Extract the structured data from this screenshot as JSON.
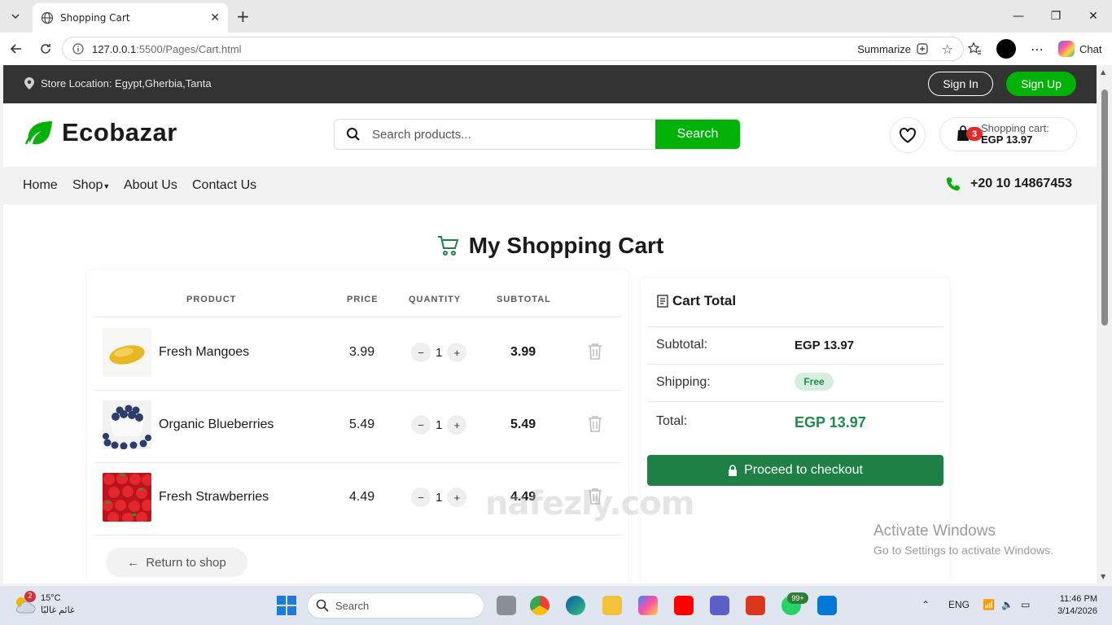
{
  "browser": {
    "tab_title": "Shopping Cart",
    "url_host": "127.0.0.1",
    "url_path": ":5500/Pages/Cart.html",
    "summarize_label": "Summarize",
    "chat_label": "Chat"
  },
  "topbar": {
    "location": "Store Location: Egypt,Gherbia,Tanta",
    "signin": "Sign In",
    "signup": "Sign Up"
  },
  "header": {
    "brand": "Ecobazar",
    "search_placeholder": "Search products...",
    "search_button": "Search",
    "cart_count": "3",
    "cart_label": "Shopping cart:",
    "cart_amount": "EGP 13.97"
  },
  "nav": {
    "home": "Home",
    "shop": "Shop",
    "about": "About Us",
    "contact": "Contact Us",
    "phone": "+20 10 14867453"
  },
  "page": {
    "title": "My Shopping Cart"
  },
  "cart": {
    "headers": {
      "product": "PRODUCT",
      "price": "PRICE",
      "quantity": "QUANTITY",
      "subtotal": "SUBTOTAL"
    },
    "items": [
      {
        "name": "Fresh Mangoes",
        "price": "3.99",
        "qty": "1",
        "subtotal": "3.99"
      },
      {
        "name": "Organic Blueberries",
        "price": "5.49",
        "qty": "1",
        "subtotal": "5.49"
      },
      {
        "name": "Fresh Strawberries",
        "price": "4.49",
        "qty": "1",
        "subtotal": "4.49"
      }
    ],
    "return_label": "Return to shop"
  },
  "totals": {
    "title": "Cart Total",
    "subtotal_label": "Subtotal:",
    "subtotal_value": "EGP 13.97",
    "shipping_label": "Shipping:",
    "shipping_value": "Free",
    "total_label": "Total:",
    "total_value": "EGP 13.97",
    "checkout_label": "Proceed to checkout"
  },
  "overlay": {
    "activate_title": "Activate Windows",
    "activate_sub": "Go to Settings to activate Windows.",
    "watermark": "nafezly.com"
  },
  "taskbar": {
    "weather_badge": "2",
    "temp": "15°C",
    "weather_desc": "غائم غالبًا",
    "search_label": "Search",
    "whatsapp_badge": "99+",
    "lang": "ENG",
    "time": "11:46 PM",
    "date": "3/14/2026"
  },
  "colors": {
    "brand_green": "#00b207",
    "dark_green": "#1e8045",
    "topbar": "#333333",
    "badge_red": "#e02b2b"
  }
}
